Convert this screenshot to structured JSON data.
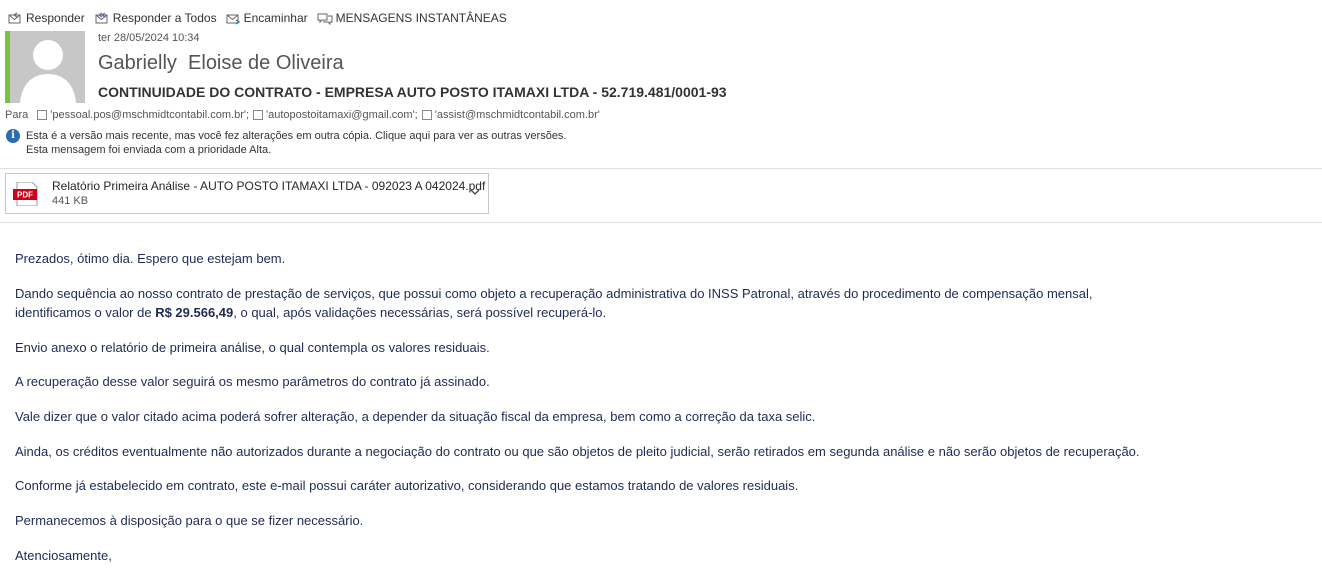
{
  "toolbar": {
    "reply": "Responder",
    "reply_all": "Responder a Todos",
    "forward": "Encaminhar",
    "instant_messages": "MENSAGENS INSTANTÂNEAS"
  },
  "message": {
    "date": "ter 28/05/2024 10:34",
    "sender": "Gabrielly  Eloise de Oliveira",
    "subject": "CONTINUIDADE DO CONTRATO - EMPRESA AUTO POSTO ITAMAXI LTDA - 52.719.481/0001-93",
    "to_label": "Para",
    "recipients": [
      "'pessoal.pos@mschmidtcontabil.com.br';",
      "'autopostoitamaxi@gmail.com';",
      "'assist@mschmidtcontabil.com.br'"
    ],
    "info_lines": [
      "Esta é a versão mais recente, mas você fez alterações em outra cópia. Clique aqui para ver as outras versões.",
      "Esta mensagem foi enviada com a prioridade Alta."
    ]
  },
  "attachment": {
    "name": "Relatório Primeira Análise - AUTO POSTO ITAMAXI LTDA - 092023 A 042024.pdf",
    "size": "441 KB",
    "type_label": "PDF"
  },
  "body": {
    "greeting": "Prezados, ótimo dia. Espero que estejam bem.",
    "p2_line1": "Dando sequência ao nosso contrato de prestação de serviços, que possui como objeto a recuperação administrativa do INSS Patronal, através do procedimento de compensação mensal,",
    "p2_line2_pre": "identificamos o valor de ",
    "p2_amount": "R$ 29.566,49",
    "p2_line2_post": ", o qual, após validações necessárias, será possível recuperá-lo.",
    "p3": "Envio anexo o relatório de primeira análise, o qual contempla os valores residuais.",
    "p4": "A recuperação desse valor seguirá os mesmo parâmetros do contrato já assinado.",
    "p5": "Vale dizer que o valor citado acima poderá sofrer alteração, a depender da situação fiscal da empresa, bem como a correção da taxa selic.",
    "p6": "Ainda, os créditos eventualmente não autorizados durante a negociação do contrato ou que são objetos de pleito judicial, serão retirados em segunda análise e não serão objetos de recuperação.",
    "p7": "Conforme já estabelecido em contrato, este e-mail possui caráter autorizativo, considerando que estamos tratando de valores residuais.",
    "p8": "Permanecemos à disposição para o que se fizer necessário.",
    "p9": "Atenciosamente,"
  },
  "colors": {
    "accent_bar": "#7ac142",
    "body_text": "#1f2a55",
    "info_icon": "#2b6cb0",
    "pdf_red": "#d0021b"
  }
}
